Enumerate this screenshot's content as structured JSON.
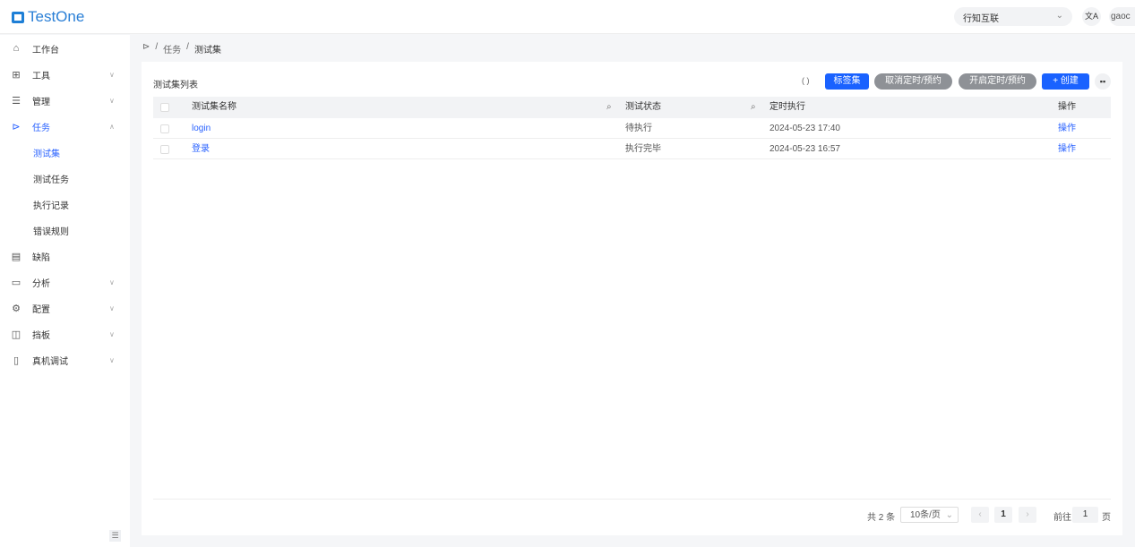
{
  "header": {
    "logo": "TestOne",
    "org": "行知互联",
    "lang_icon": "translate-icon",
    "user": "gaoc"
  },
  "sidebar": {
    "items": [
      {
        "label": "工作台",
        "icon": "⌂"
      },
      {
        "label": "工具",
        "icon": "⊞"
      },
      {
        "label": "管理",
        "icon": "☰"
      },
      {
        "label": "任务",
        "icon": "⊳"
      },
      {
        "label": "测试集"
      },
      {
        "label": "测试任务"
      },
      {
        "label": "执行记录"
      },
      {
        "label": "错误规则"
      },
      {
        "label": "缺陷",
        "icon": "▤"
      },
      {
        "label": "分析",
        "icon": "▭"
      },
      {
        "label": "配置",
        "icon": "⚙"
      },
      {
        "label": "挡板",
        "icon": "◫"
      },
      {
        "label": "真机调试",
        "icon": "▯"
      }
    ]
  },
  "breadcrumb": [
    "任务",
    "测试集"
  ],
  "card": {
    "title": "测试集列表",
    "buttons": {
      "tags": "标签集",
      "cancel_schedule": "取消定时/预约",
      "enable_schedule": "开启定时/预约",
      "create": "+ 创建"
    }
  },
  "table": {
    "columns": [
      "测试集名称",
      "测试状态",
      "定时执行",
      "操作"
    ],
    "rows": [
      {
        "name": "login",
        "status": "待执行",
        "time": "2024-05-23 17:40",
        "action": "操作"
      },
      {
        "name": "登录",
        "status": "执行完毕",
        "time": "2024-05-23 16:57",
        "action": "操作"
      }
    ]
  },
  "pagination": {
    "total": "共 2 条",
    "page_size": "10条/页",
    "current": "1",
    "goto_label": "前往",
    "goto_value": "1",
    "page_unit": "页"
  }
}
